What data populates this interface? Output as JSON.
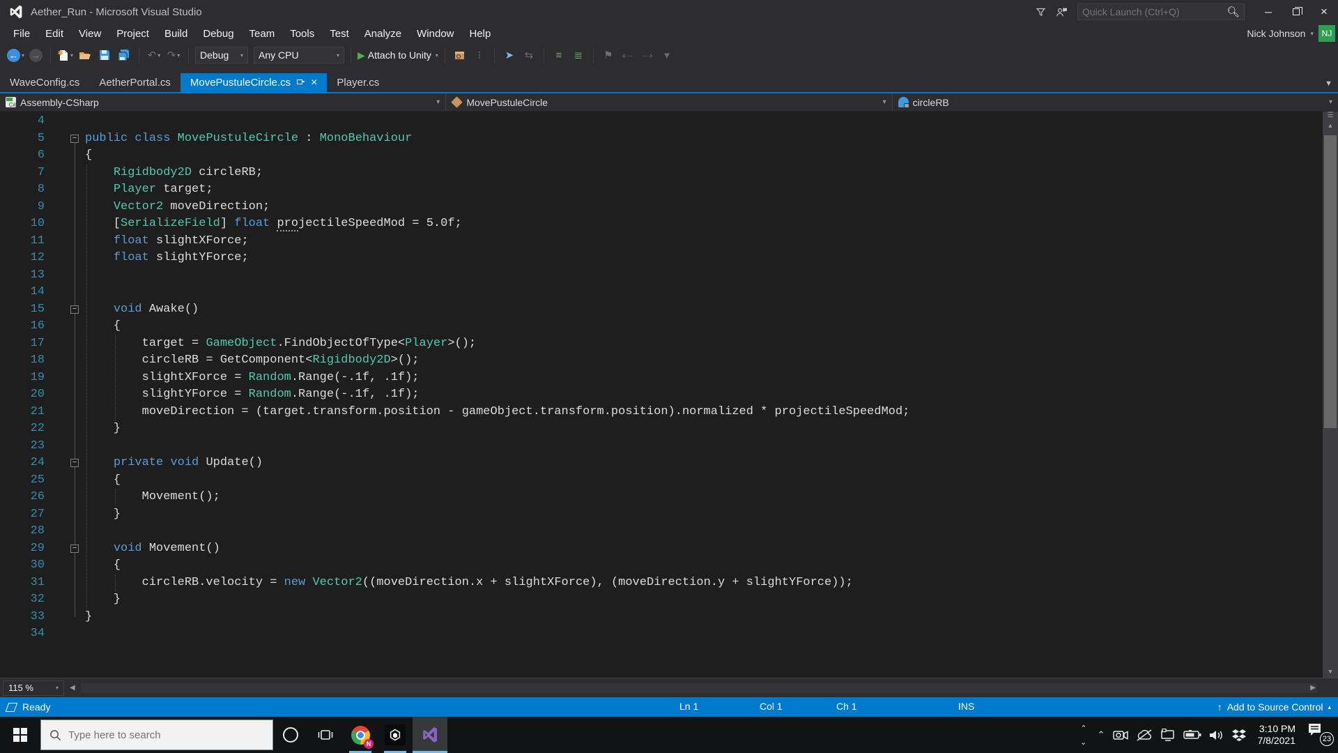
{
  "window": {
    "title": "Aether_Run - Microsoft Visual Studio",
    "quick_launch_placeholder": "Quick Launch (Ctrl+Q)",
    "user": "Nick Johnson",
    "avatar_initials": "NJ"
  },
  "menu": {
    "items": [
      "File",
      "Edit",
      "View",
      "Project",
      "Build",
      "Debug",
      "Team",
      "Tools",
      "Test",
      "Analyze",
      "Window",
      "Help"
    ]
  },
  "toolbar": {
    "config": "Debug",
    "platform": "Any CPU",
    "attach_label": "Attach to Unity"
  },
  "tabs": [
    {
      "label": "WaveConfig.cs",
      "active": false
    },
    {
      "label": "AetherPortal.cs",
      "active": false
    },
    {
      "label": "MovePustuleCircle.cs",
      "active": true
    },
    {
      "label": "Player.cs",
      "active": false
    }
  ],
  "navbar": {
    "project": "Assembly-CSharp",
    "type": "MovePustuleCircle",
    "member": "circleRB"
  },
  "editor": {
    "zoom_level": "115 %",
    "lines": [
      {
        "n": 4,
        "tokens": []
      },
      {
        "n": 5,
        "fold": true,
        "tokens": [
          [
            "k",
            "public"
          ],
          [
            "p",
            " "
          ],
          [
            "k",
            "class"
          ],
          [
            "p",
            " "
          ],
          [
            "t",
            "MovePustuleCircle"
          ],
          [
            "p",
            " : "
          ],
          [
            "t",
            "MonoBehaviour"
          ]
        ]
      },
      {
        "n": 6,
        "tokens": [
          [
            "p",
            "{"
          ]
        ]
      },
      {
        "n": 7,
        "tokens": [
          [
            "p",
            "    "
          ],
          [
            "t",
            "Rigidbody2D"
          ],
          [
            "p",
            " circleRB;"
          ]
        ]
      },
      {
        "n": 8,
        "tokens": [
          [
            "p",
            "    "
          ],
          [
            "t",
            "Player"
          ],
          [
            "p",
            " target;"
          ]
        ]
      },
      {
        "n": 9,
        "tokens": [
          [
            "p",
            "    "
          ],
          [
            "t",
            "Vector2"
          ],
          [
            "p",
            " moveDirection;"
          ]
        ]
      },
      {
        "n": 10,
        "tokens": [
          [
            "p",
            "    ["
          ],
          [
            "t",
            "SerializeField"
          ],
          [
            "p",
            "] "
          ],
          [
            "k",
            "float"
          ],
          [
            "p",
            " "
          ],
          [
            "d",
            "pro"
          ],
          [
            "p",
            "jectileSpeedMod = 5.0f;"
          ]
        ]
      },
      {
        "n": 11,
        "tokens": [
          [
            "p",
            "    "
          ],
          [
            "k",
            "float"
          ],
          [
            "p",
            " slightXForce;"
          ]
        ]
      },
      {
        "n": 12,
        "tokens": [
          [
            "p",
            "    "
          ],
          [
            "k",
            "float"
          ],
          [
            "p",
            " slightYForce;"
          ]
        ]
      },
      {
        "n": 13,
        "tokens": []
      },
      {
        "n": 14,
        "tokens": []
      },
      {
        "n": 15,
        "fold": true,
        "tokens": [
          [
            "p",
            "    "
          ],
          [
            "k",
            "void"
          ],
          [
            "p",
            " Awake()"
          ]
        ]
      },
      {
        "n": 16,
        "tokens": [
          [
            "p",
            "    {"
          ]
        ]
      },
      {
        "n": 17,
        "tokens": [
          [
            "p",
            "        target = "
          ],
          [
            "t",
            "GameObject"
          ],
          [
            "p",
            ".FindObjectOfType<"
          ],
          [
            "t",
            "Player"
          ],
          [
            "p",
            ">();"
          ]
        ]
      },
      {
        "n": 18,
        "tokens": [
          [
            "p",
            "        circleRB = GetComponent<"
          ],
          [
            "t",
            "Rigidbody2D"
          ],
          [
            "p",
            ">();"
          ]
        ]
      },
      {
        "n": 19,
        "tokens": [
          [
            "p",
            "        slightXForce = "
          ],
          [
            "t",
            "Random"
          ],
          [
            "p",
            ".Range(-.1f, .1f);"
          ]
        ]
      },
      {
        "n": 20,
        "tokens": [
          [
            "p",
            "        slightYForce = "
          ],
          [
            "t",
            "Random"
          ],
          [
            "p",
            ".Range(-.1f, .1f);"
          ]
        ]
      },
      {
        "n": 21,
        "tokens": [
          [
            "p",
            "        moveDirection = (target.transform.position - gameObject.transform.position).normalized * projectileSpeedMod;"
          ]
        ]
      },
      {
        "n": 22,
        "tokens": [
          [
            "p",
            "    }"
          ]
        ]
      },
      {
        "n": 23,
        "tokens": []
      },
      {
        "n": 24,
        "fold": true,
        "tokens": [
          [
            "p",
            "    "
          ],
          [
            "k",
            "private"
          ],
          [
            "p",
            " "
          ],
          [
            "k",
            "void"
          ],
          [
            "p",
            " Update()"
          ]
        ]
      },
      {
        "n": 25,
        "tokens": [
          [
            "p",
            "    {"
          ]
        ]
      },
      {
        "n": 26,
        "tokens": [
          [
            "p",
            "        Movement();"
          ]
        ]
      },
      {
        "n": 27,
        "tokens": [
          [
            "p",
            "    }"
          ]
        ]
      },
      {
        "n": 28,
        "tokens": []
      },
      {
        "n": 29,
        "fold": true,
        "tokens": [
          [
            "p",
            "    "
          ],
          [
            "k",
            "void"
          ],
          [
            "p",
            " Movement()"
          ]
        ]
      },
      {
        "n": 30,
        "tokens": [
          [
            "p",
            "    {"
          ]
        ]
      },
      {
        "n": 31,
        "tokens": [
          [
            "p",
            "        circleRB.velocity = "
          ],
          [
            "k",
            "new"
          ],
          [
            "p",
            " "
          ],
          [
            "t",
            "Vector2"
          ],
          [
            "p",
            "((moveDirection.x + slightXForce), (moveDirection.y + slightYForce));"
          ]
        ]
      },
      {
        "n": 32,
        "tokens": [
          [
            "p",
            "    }"
          ]
        ]
      },
      {
        "n": 33,
        "tokens": [
          [
            "p",
            "}"
          ]
        ]
      },
      {
        "n": 34,
        "tokens": []
      }
    ]
  },
  "status": {
    "ready": "Ready",
    "ln": "Ln 1",
    "col": "Col 1",
    "ch": "Ch 1",
    "mode": "INS",
    "source_control": "Add to Source Control"
  },
  "taskbar": {
    "search_placeholder": "Type here to search",
    "time": "3:10 PM",
    "date": "7/8/2021",
    "notification_count": "23"
  },
  "colors": {
    "accent": "#007ACC",
    "chrome_bg": "#2D2D30",
    "editor_bg": "#1E1E1E",
    "keyword": "#569CD6",
    "type": "#4EC9B0",
    "code_text": "#DCDCDC",
    "line_number": "#2B91AF",
    "avatar_bg": "#2EA052",
    "taskbar_bg": "#111314"
  }
}
